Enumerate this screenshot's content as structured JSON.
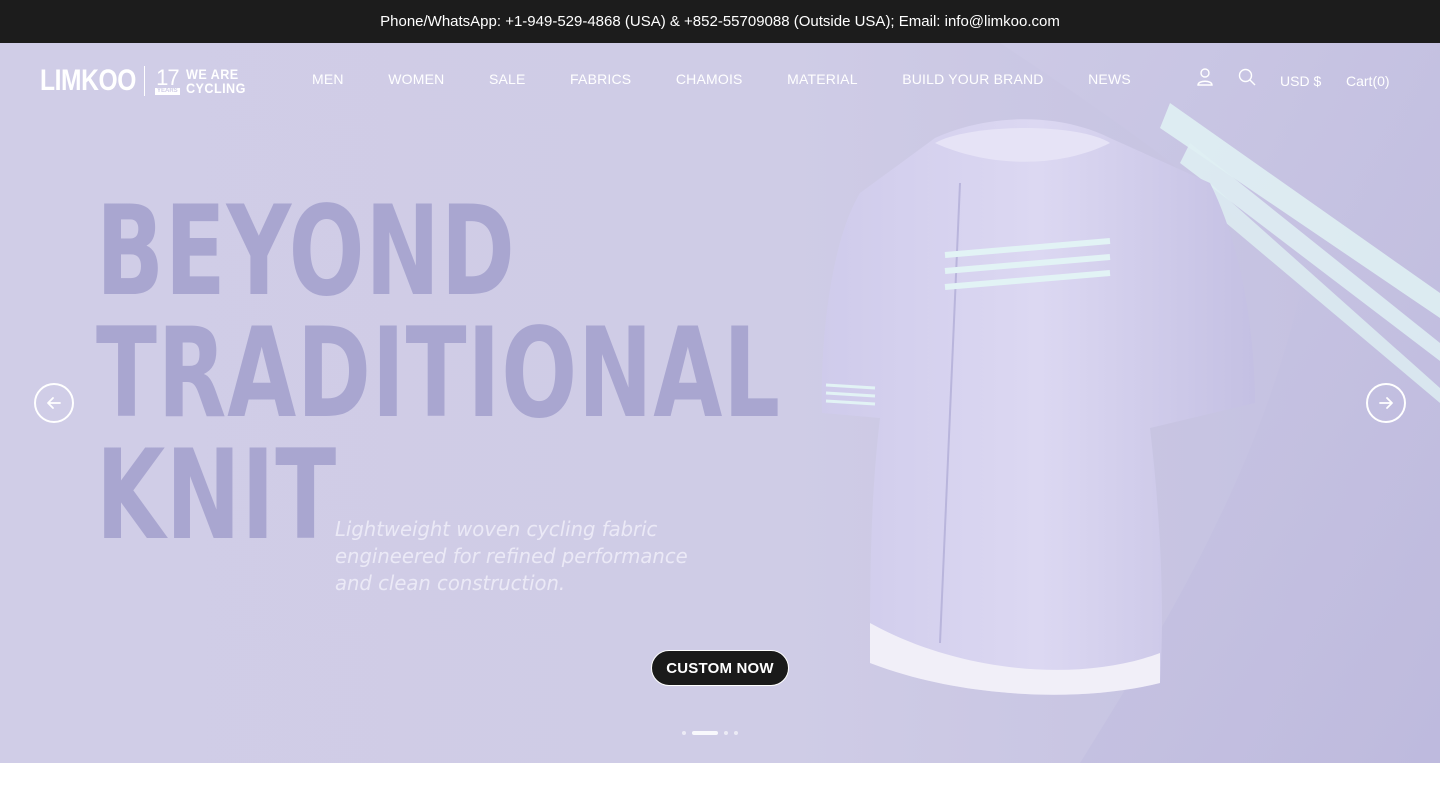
{
  "topbar": {
    "contact_text": "Phone/WhatsApp: +1-949-529-4868 (USA) & +852-55709088 (Outside USA); Email: info@limkoo.com"
  },
  "brand": {
    "name": "LIMKOO",
    "years_number": "17",
    "years_label": "YEARS",
    "tagline_line1": "WE ARE",
    "tagline_line2": "CYCLING"
  },
  "nav": {
    "items": [
      {
        "label": "MEN"
      },
      {
        "label": "WOMEN"
      },
      {
        "label": "SALE"
      },
      {
        "label": "FABRICS"
      },
      {
        "label": "CHAMOIS"
      },
      {
        "label": "MATERIAL"
      },
      {
        "label": "BUILD YOUR BRAND"
      },
      {
        "label": "NEWS"
      }
    ],
    "account_icon": "user-icon",
    "search_icon": "search-icon",
    "currency_label": "USD $",
    "cart_label": "Cart(0)"
  },
  "hero": {
    "headline_line1": "BEYOND",
    "headline_line2": "TRADITIONAL",
    "headline_line3": "KNIT",
    "subcopy_line1": "Lightweight woven cycling fabric",
    "subcopy_line2": "engineered for refined performance",
    "subcopy_line3": "and clean construction.",
    "cta_label": "CUSTOM NOW",
    "prev_icon": "arrow-left-icon",
    "next_icon": "arrow-right-icon",
    "slide_count": 4,
    "active_slide": 1
  },
  "colors": {
    "topbar_bg": "#1c1c1c",
    "hero_bg": "#cfcce6",
    "headline": "#a9a6d0",
    "cta_bg": "#1a1a1a"
  }
}
